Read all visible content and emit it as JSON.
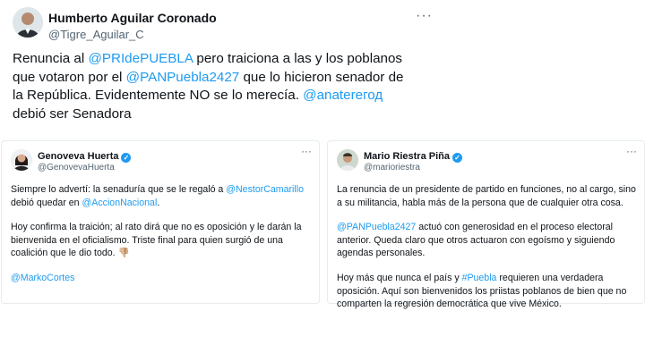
{
  "main_tweet": {
    "author_name": "Humberto Aguilar Coronado",
    "author_handle": "@Tigre_Aguilar_C",
    "more_icon": "more-dots-icon",
    "text": {
      "t1": "Renuncia al ",
      "m1": "@PRIdePUEBLA",
      "t2": " pero traiciona a las y los poblanos que votaron por el ",
      "m2": "@PANPuebla2427",
      "t3": " que lo hicieron senador de la República. Evidentemente NO se lo merecía. ",
      "m3": "@anatereгод",
      "t4": " debió ser Senadora"
    }
  },
  "left_card": {
    "author_name": "Genoveva Huerta",
    "author_handle": "@GenovevaHuerta",
    "p1": {
      "t1": "Siempre lo advertí: la senaduría que se le regaló a ",
      "m1": "@NestorCamarillo",
      "t2": " debió quedar en ",
      "m2": "@AccionNacional",
      "t3": "."
    },
    "p2": {
      "t1": "Hoy confirma la traición; al rato dirá que no es oposición y le darán la bienvenida en el oficialismo. Triste final para quien surgió de una coalición que le dio todo. ",
      "emoji": "👎🏼"
    },
    "p3": {
      "m1": "@MarkoCortes"
    }
  },
  "right_card": {
    "author_name": "Mario Riestra Piña",
    "author_handle": "@marioriestra",
    "p1": {
      "t1": "La renuncia de un presidente de partido en funciones, no al cargo, sino a su militancia, habla más de la persona que de cualquier otra cosa."
    },
    "p2": {
      "m1": "@PANPuebla2427",
      "t1": " actuó con generosidad en el proceso electoral anterior. Queda claro que otros actuaron con egoísmo y siguiendo agendas personales."
    },
    "p3": {
      "t1": "Hoy más que nunca el país y ",
      "m1": "#Puebla",
      "t2": " requieren una verdadera oposición. Aquí son bienvenidos los priistas poblanos de bien que no comparten la regresión democrática que vive México."
    }
  },
  "colors": {
    "mention": "#1d9bf0",
    "text": "#0f1419",
    "muted": "#536471",
    "border": "#e6ecf0"
  }
}
